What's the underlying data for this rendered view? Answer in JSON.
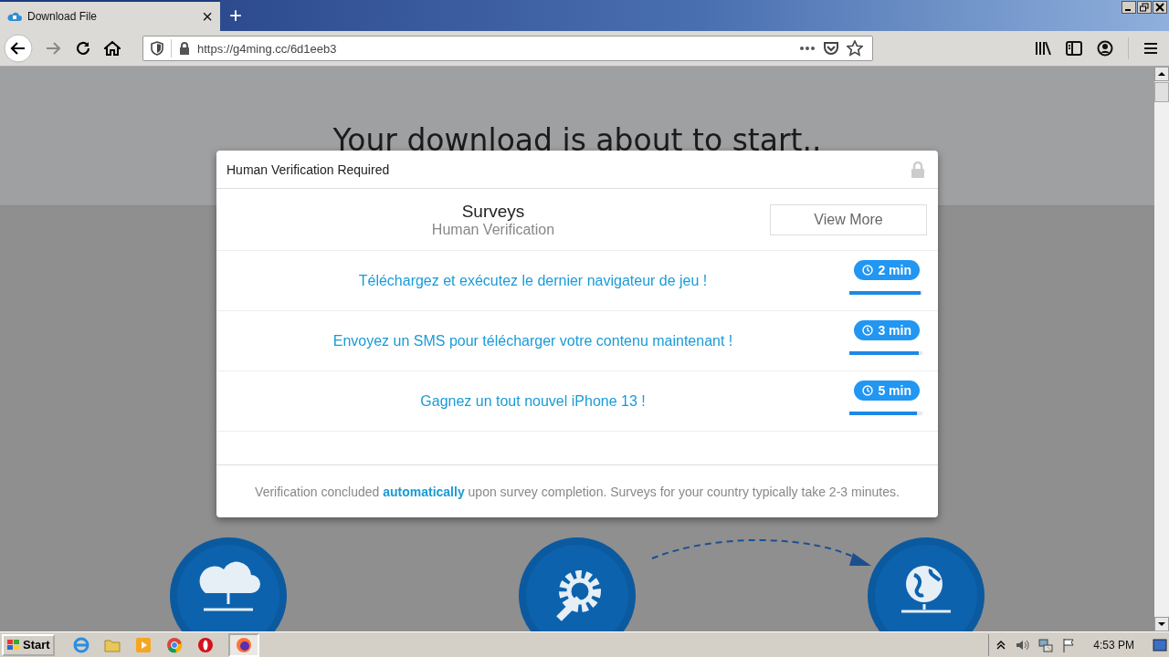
{
  "browser": {
    "tab": {
      "title": "Download File",
      "close": "×"
    },
    "new_tab": "+",
    "url": "https://g4ming.cc/6d1eeb3"
  },
  "page": {
    "heading": "Your download is about to start.."
  },
  "modal": {
    "title": "Human Verification Required",
    "section_title": "Surveys",
    "section_subtitle": "Human Verification",
    "view_more": "View More",
    "offers": [
      {
        "text": "Téléchargez et exécutez le dernier navigateur de jeu !",
        "time": "2 min",
        "level": 0.97
      },
      {
        "text": "Envoyez un SMS pour télécharger votre contenu maintenant !",
        "time": "3 min",
        "level": 0.95
      },
      {
        "text": "Gagnez un tout nouvel iPhone 13 !",
        "time": "5 min",
        "level": 0.92
      }
    ],
    "footer": "Verification concluded **automatically** upon survey completion. Surveys for your country typically take 2-3 minutes."
  },
  "taskbar": {
    "start": "Start",
    "clock": "4:53 PM"
  }
}
